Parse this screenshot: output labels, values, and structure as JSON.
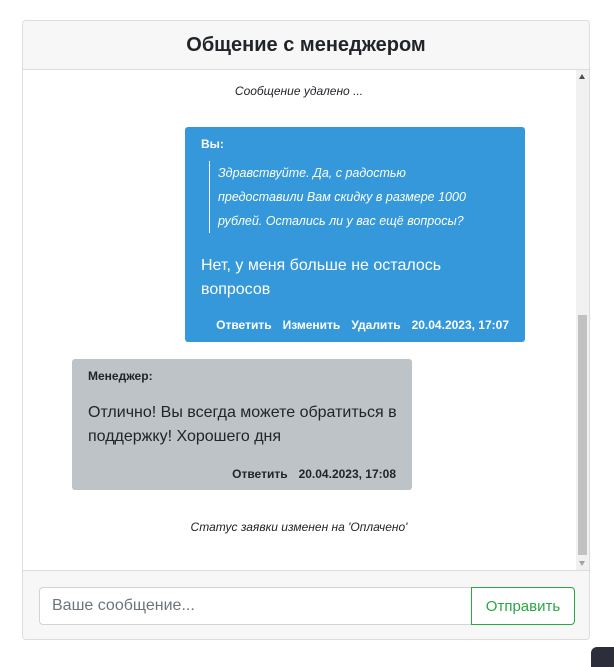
{
  "header": {
    "title": "Общение с менеджером"
  },
  "chat": {
    "system_deleted": "Сообщение удалено ...",
    "own_message": {
      "author": "Вы:",
      "quote": "Здравствуйте. Да, с радостью предоставили Вам скидку в размере 1000 рублей. Остались ли у вас ещё вопросы?",
      "text": "Нет, у меня больше не осталось вопросов",
      "reply_label": "Ответить",
      "edit_label": "Изменить",
      "delete_label": "Удалить",
      "timestamp": "20.04.2023, 17:07",
      "bg_color": "#3498db"
    },
    "manager_message": {
      "author": "Менеджер:",
      "text": "Отлично! Вы всегда можете обратиться в поддержку! Хорошего дня",
      "reply_label": "Ответить",
      "timestamp": "20.04.2023, 17:08",
      "bg_color": "#bdc3c7"
    },
    "system_status": "Статус заявки изменен на 'Оплачено'"
  },
  "footer": {
    "input_placeholder": "Ваше сообщение...",
    "input_value": "",
    "send_label": "Отправить",
    "send_color": "#28a745"
  }
}
